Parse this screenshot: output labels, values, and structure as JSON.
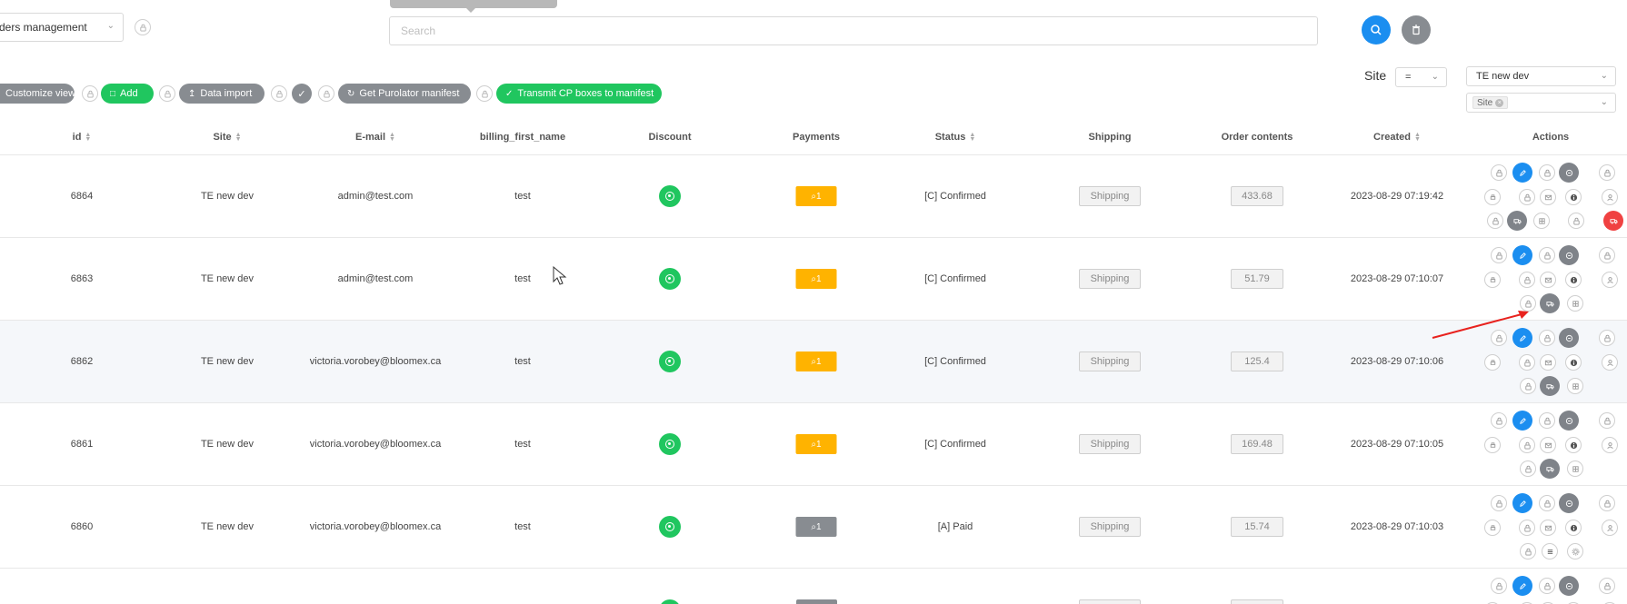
{
  "header": {
    "module_select": "ders management",
    "search_placeholder": "Search"
  },
  "toolbar": {
    "customize_view": "Customize view",
    "add": "Add",
    "data_import": "Data import",
    "get_purolator_manifest": "Get Purolator manifest",
    "transmit_cp_boxes": "Transmit CP boxes to manifest"
  },
  "filters": {
    "site_label": "Site",
    "operator": "=",
    "site_value": "TE new dev",
    "site_tag": "Site"
  },
  "columns": [
    "id",
    "Site",
    "E-mail",
    "billing_first_name",
    "Discount",
    "Payments",
    "Status",
    "Shipping",
    "Order contents",
    "Created",
    "Actions"
  ],
  "rows": [
    {
      "id": "6864",
      "site": "TE new dev",
      "email": "admin@test.com",
      "first_name": "test",
      "payments": "1",
      "payment_color": "orange",
      "status": "[C] Confirmed",
      "shipping": "Shipping",
      "contents": "433.68",
      "created": "2023-08-29 07:19:42",
      "variant": "a"
    },
    {
      "id": "6863",
      "site": "TE new dev",
      "email": "admin@test.com",
      "first_name": "test",
      "payments": "1",
      "payment_color": "orange",
      "status": "[C] Confirmed",
      "shipping": "Shipping",
      "contents": "51.79",
      "created": "2023-08-29 07:10:07",
      "variant": "b"
    },
    {
      "id": "6862",
      "site": "TE new dev",
      "email": "victoria.vorobey@bloomex.ca",
      "first_name": "test",
      "payments": "1",
      "payment_color": "orange",
      "status": "[C] Confirmed",
      "shipping": "Shipping",
      "contents": "125.4",
      "created": "2023-08-29 07:10:06",
      "variant": "b"
    },
    {
      "id": "6861",
      "site": "TE new dev",
      "email": "victoria.vorobey@bloomex.ca",
      "first_name": "test",
      "payments": "1",
      "payment_color": "orange",
      "status": "[C] Confirmed",
      "shipping": "Shipping",
      "contents": "169.48",
      "created": "2023-08-29 07:10:05",
      "variant": "b"
    },
    {
      "id": "6860",
      "site": "TE new dev",
      "email": "victoria.vorobey@bloomex.ca",
      "first_name": "test",
      "payments": "1",
      "payment_color": "gray",
      "status": "[A] Paid",
      "shipping": "Shipping",
      "contents": "15.74",
      "created": "2023-08-29 07:10:03",
      "variant": "c"
    }
  ],
  "colors": {
    "accent_blue": "#1b8ef0",
    "success_green": "#20c65f",
    "warning_orange": "#ffb300",
    "neutral_gray": "#888c91",
    "danger_red": "#f04141"
  }
}
